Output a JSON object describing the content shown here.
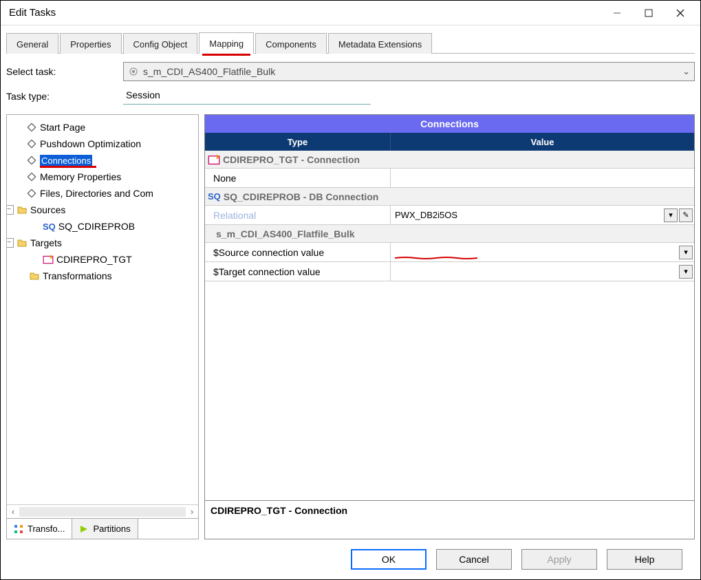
{
  "window": {
    "title": "Edit Tasks"
  },
  "tabs": [
    {
      "label": "General"
    },
    {
      "label": "Properties"
    },
    {
      "label": "Config Object"
    },
    {
      "label": "Mapping",
      "active": true
    },
    {
      "label": "Components"
    },
    {
      "label": "Metadata Extensions"
    }
  ],
  "form": {
    "select_task_label": "Select task:",
    "select_task_value": "s_m_CDI_AS400_Flatfile_Bulk",
    "task_type_label": "Task type:",
    "task_type_value": "Session"
  },
  "tree": {
    "items": [
      {
        "label": "Start Page",
        "icon": "diamond"
      },
      {
        "label": "Pushdown Optimization",
        "icon": "diamond"
      },
      {
        "label": "Connections",
        "icon": "diamond",
        "selected": true,
        "red": true
      },
      {
        "label": "Memory Properties",
        "icon": "diamond"
      },
      {
        "label": "Files, Directories and Com",
        "icon": "diamond"
      }
    ],
    "sources": {
      "label": "Sources",
      "child": {
        "label": "SQ_CDIREPROB",
        "prefix": "SQ"
      }
    },
    "targets": {
      "label": "Targets",
      "child": {
        "label": "CDIREPRO_TGT"
      }
    },
    "transforms_label": "Transformations",
    "subtabs": {
      "t1": "Transfo...",
      "t2": "Partitions"
    }
  },
  "grid": {
    "title": "Connections",
    "headers": {
      "type": "Type",
      "value": "Value"
    },
    "sections": [
      {
        "icon": "target",
        "label": "CDIREPRO_TGT - Connection",
        "rows": [
          {
            "type": "None",
            "value": ""
          }
        ]
      },
      {
        "icon": "sq",
        "label": "SQ_CDIREPROB - DB Connection",
        "rows": [
          {
            "type": "Relational",
            "value": "PWX_DB2i5OS",
            "relational": true,
            "buttons": 2
          }
        ]
      },
      {
        "icon": "none",
        "label": "s_m_CDI_AS400_Flatfile_Bulk",
        "rows": [
          {
            "type": "$Source connection value",
            "value": "",
            "buttons": 1,
            "red": true
          },
          {
            "type": "$Target connection value",
            "value": "",
            "buttons": 1
          }
        ]
      }
    ],
    "footer": "CDIREPRO_TGT - Connection"
  },
  "buttons": {
    "ok": "OK",
    "cancel": "Cancel",
    "apply": "Apply",
    "help": "Help"
  }
}
